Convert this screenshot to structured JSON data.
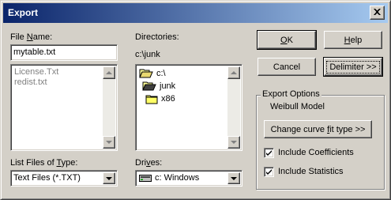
{
  "window": {
    "title": "Export",
    "close_glyph": "×"
  },
  "file_name": {
    "label_pre": "File ",
    "label_key": "N",
    "label_post": "ame:",
    "value": "mytable.txt",
    "list": [
      "License.Txt",
      "redist.txt"
    ]
  },
  "file_type": {
    "label_pre": "List Files of ",
    "label_key": "T",
    "label_post": "ype:",
    "selected": "Text Files (*.TXT)"
  },
  "directories": {
    "label": "Directories:",
    "current": "c:\\junk",
    "tree": [
      {
        "name": "c:\\",
        "state": "open"
      },
      {
        "name": "junk",
        "state": "open-selected"
      },
      {
        "name": "x86",
        "state": "closed"
      }
    ]
  },
  "drives": {
    "label_pre": "Dri",
    "label_key": "v",
    "label_post": "es:",
    "selected": "c: Windows"
  },
  "buttons": {
    "ok_key": "O",
    "ok_rest": "K",
    "help_key": "H",
    "help_rest": "elp",
    "cancel": "Cancel",
    "delimiter": "Delimiter >>"
  },
  "export_options": {
    "title": "Export Options",
    "model": "Weibull Model",
    "change_fit_pre": "Change curve ",
    "change_fit_key": "f",
    "change_fit_post": "it type >>",
    "include_coefficients": {
      "label": "Include Coefficients",
      "checked": true
    },
    "include_statistics": {
      "label": "Include Statistics",
      "checked": true
    }
  }
}
